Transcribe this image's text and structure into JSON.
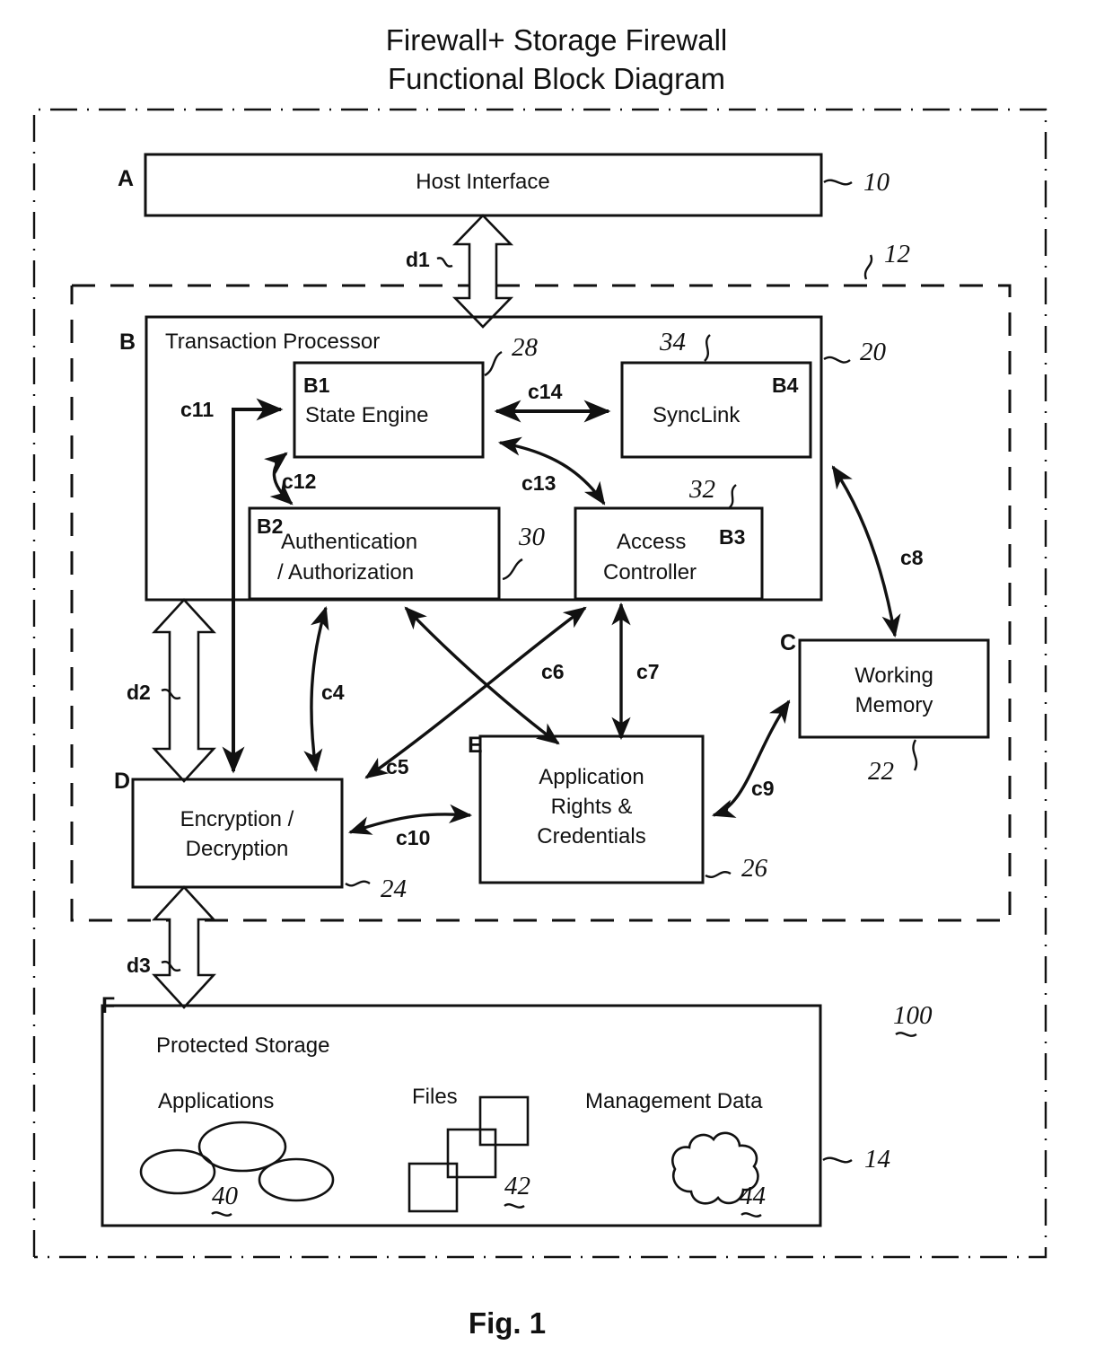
{
  "figure": {
    "title_line1": "Firewall+ Storage Firewall",
    "title_line2": "Functional Block Diagram",
    "caption": "Fig. 1",
    "overall_ref": "100"
  },
  "outer_letters": {
    "a": "A",
    "b": "B",
    "c": "C",
    "d": "D",
    "e": "E",
    "f": "F"
  },
  "blocks": {
    "host_interface": {
      "label": "Host Interface",
      "ref": "10"
    },
    "transaction_processor": {
      "label": "Transaction Processor",
      "ref": "20"
    },
    "state_engine": {
      "tag": "B1",
      "label": "State Engine",
      "ref": "28"
    },
    "sync_link": {
      "tag": "B4",
      "label": "SyncLink",
      "ref": "34"
    },
    "authentication": {
      "tag": "B2",
      "label_line1": "Authentication",
      "label_line2": "/ Authorization",
      "ref": "30"
    },
    "access_controller": {
      "tag": "B3",
      "label_line1": "Access",
      "label_line2": "Controller",
      "ref": "32"
    },
    "working_memory": {
      "label_line1": "Working",
      "label_line2": "Memory",
      "ref": "22"
    },
    "encryption": {
      "label_line1": "Encryption /",
      "label_line2": "Decryption",
      "ref": "24"
    },
    "application_rights": {
      "label_line1": "Application",
      "label_line2": "Rights &",
      "label_line3": "Credentials",
      "ref": "26"
    },
    "protected_storage": {
      "label": "Protected Storage",
      "ref": "14"
    }
  },
  "storage_groups": {
    "applications": {
      "label": "Applications",
      "ref": "40"
    },
    "files": {
      "label": "Files",
      "ref": "42"
    },
    "management_data": {
      "label": "Management Data",
      "ref": "44"
    }
  },
  "boundaries": {
    "firewall_dashed_ref": "12"
  },
  "connectors": {
    "c4": "c4",
    "c5": "c5",
    "c6": "c6",
    "c7": "c7",
    "c8": "c8",
    "c9": "c9",
    "c10": "c10",
    "c11": "c11",
    "c12": "c12",
    "c13": "c13",
    "c14": "c14",
    "d1": "d1",
    "d2": "d2",
    "d3": "d3"
  }
}
